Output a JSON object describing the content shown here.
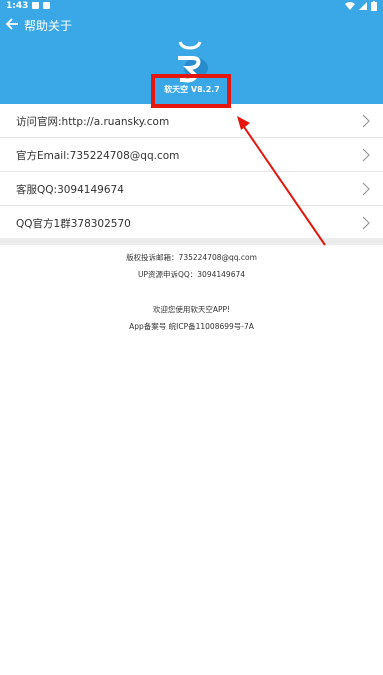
{
  "status_bar": {
    "time": "1:43"
  },
  "toolbar": {
    "title": "帮助关于",
    "back_icon": "arrow-left-icon"
  },
  "app": {
    "version": "软天空 V8.2.7",
    "logo_icon": "ruansky-logo-icon"
  },
  "rows": [
    {
      "label": "访问官网:http://a.ruansky.com"
    },
    {
      "label": "官方Email:735224708@qq.com"
    },
    {
      "label": "客服QQ:3094149674"
    },
    {
      "label": "QQ官方1群378302570"
    }
  ],
  "footer": {
    "complaint_email": "版权投诉邮箱：735224708@qq.com",
    "up_qq": "UP资源申诉QQ：3094149674",
    "welcome": "欢迎您使用软天空APP!",
    "icp": "App备案号 皖ICP备11008699号-7A"
  },
  "colors": {
    "header": "#3aa8e6",
    "highlight": "#e3170d"
  }
}
